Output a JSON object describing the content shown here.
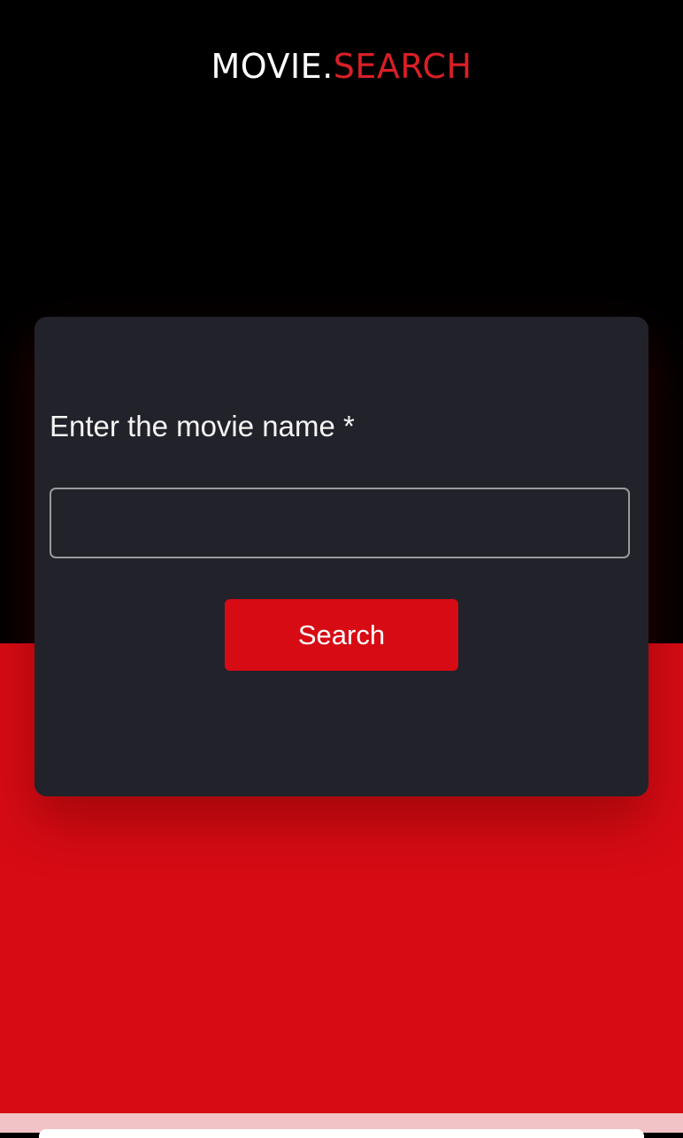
{
  "header": {
    "logo_main": "MOVIE.",
    "logo_accent": "SEARCH"
  },
  "search_form": {
    "label": "Enter the movie name *",
    "input_value": "",
    "button_label": "Search"
  },
  "colors": {
    "background_top": "#000000",
    "background_bottom": "#d70b14",
    "card": "#22222a",
    "accent": "#d91f26",
    "button": "#d70b14",
    "text": "#ffffff"
  }
}
